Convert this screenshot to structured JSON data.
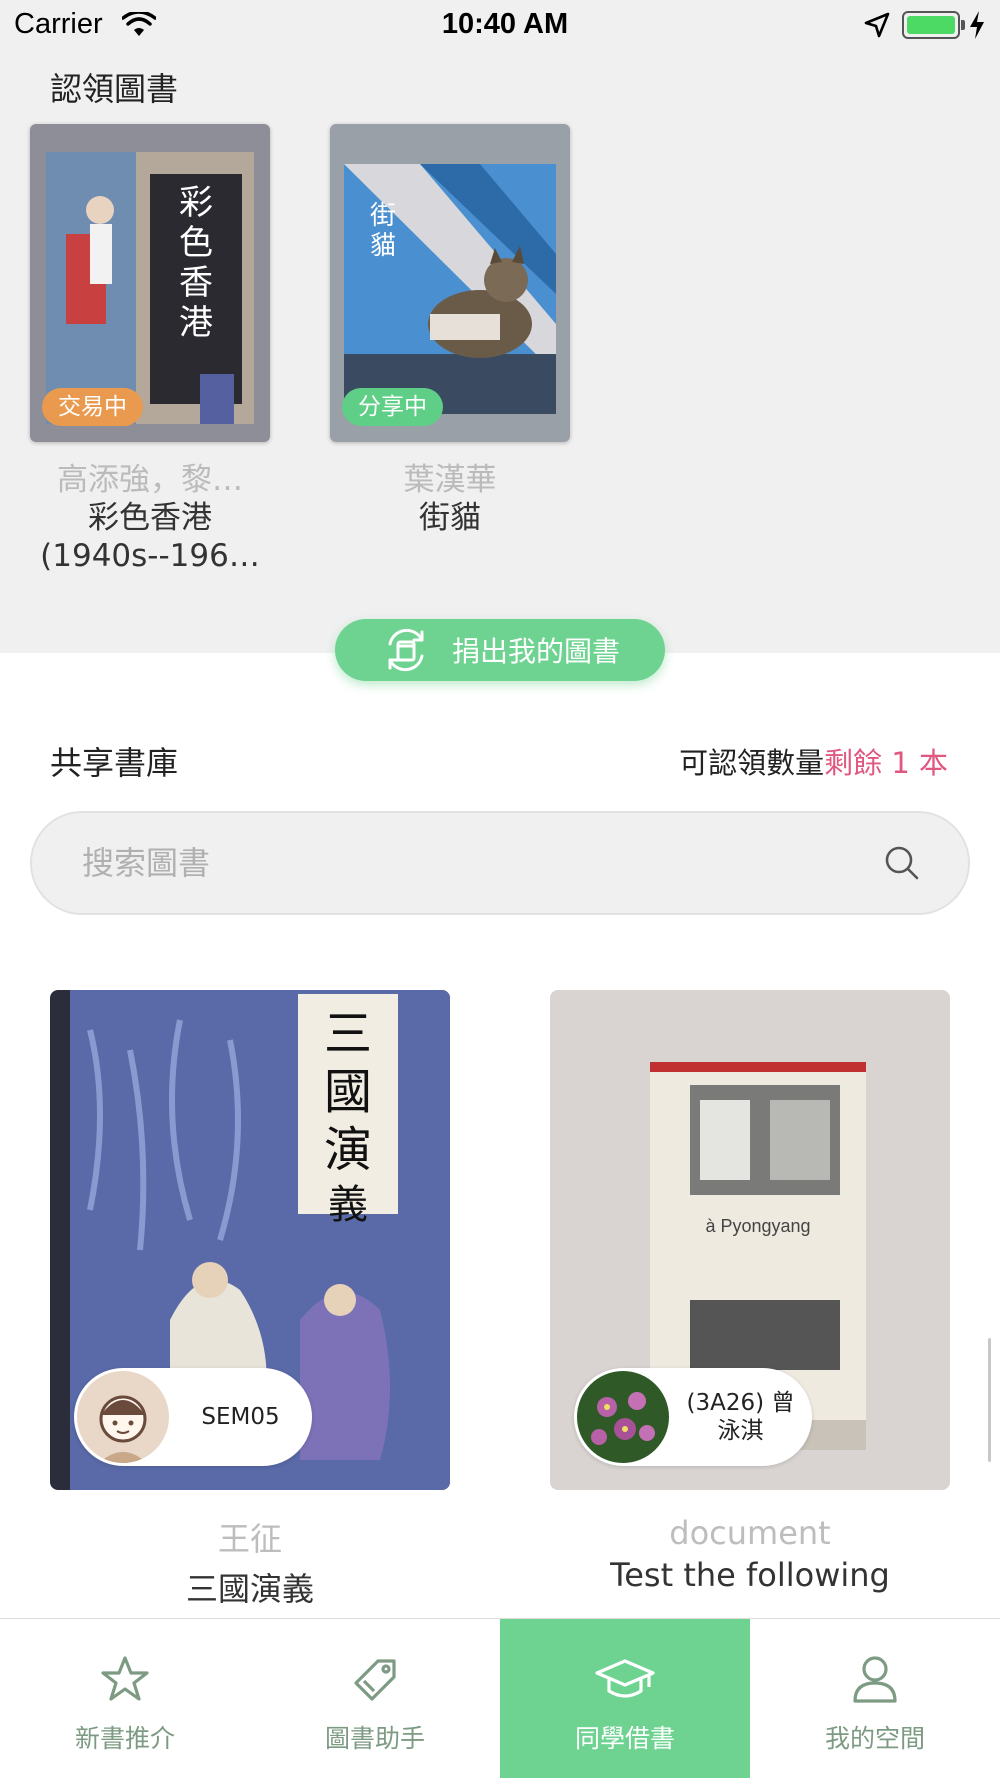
{
  "status_bar": {
    "carrier": "Carrier",
    "time": "10:40 AM"
  },
  "claimed": {
    "title": "認領圖書",
    "books": [
      {
        "status": "交易中",
        "status_color": "#ea9a4f",
        "author": "高添強，黎…",
        "title_line1": "彩色香港",
        "title_line2": "(1940s--196…"
      },
      {
        "status": "分享中",
        "status_color": "#5fce86",
        "author": "葉漢華",
        "title_line1": "街貓",
        "title_line2": ""
      }
    ]
  },
  "donate_button": {
    "label": "捐出我的圖書",
    "icon": "recycle-icon"
  },
  "shared": {
    "title": "共享書庫",
    "quota_label": "可認領數量",
    "quota_remaining": "剩餘 1 本"
  },
  "search": {
    "placeholder": "搜索圖書",
    "value": ""
  },
  "books": [
    {
      "owner": "SEM05",
      "author": "王征",
      "title": "三國演義"
    },
    {
      "owner": "(3A26) 曾泳淇",
      "author": "document",
      "title": "Test the following"
    }
  ],
  "tabs": [
    {
      "label": "新書推介",
      "icon": "star-icon",
      "active": false
    },
    {
      "label": "圖書助手",
      "icon": "tag-icon",
      "active": false
    },
    {
      "label": "同學借書",
      "icon": "graduation-cap-icon",
      "active": true
    },
    {
      "label": "我的空間",
      "icon": "user-icon",
      "active": false
    }
  ],
  "colors": {
    "accent": "#6ed391",
    "highlight": "#e0577f",
    "tab_inactive": "#7d9a83"
  }
}
